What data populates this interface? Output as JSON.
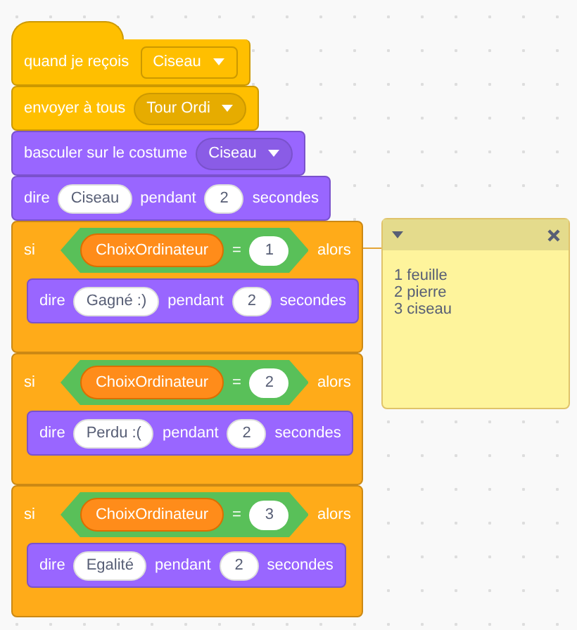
{
  "script": [
    {
      "kind": "hat",
      "color": "#ffbf00",
      "parts": [
        {
          "kind": "label",
          "text": "quand je reçois"
        },
        {
          "kind": "outlined_dropdown",
          "text": "Ciseau"
        }
      ]
    },
    {
      "kind": "stack",
      "color": "#ffbf00",
      "parts": [
        {
          "kind": "label",
          "text": "envoyer à tous"
        },
        {
          "kind": "dropdown",
          "text": "Tour Ordi"
        }
      ]
    },
    {
      "kind": "stack",
      "color": "#9966ff",
      "parts": [
        {
          "kind": "label",
          "text": "basculer sur le costume"
        },
        {
          "kind": "dropdown",
          "text": "Ciseau"
        }
      ]
    },
    {
      "kind": "stack",
      "color": "#9966ff",
      "parts": [
        {
          "kind": "label",
          "text": "dire"
        },
        {
          "kind": "input",
          "text": "Ciseau"
        },
        {
          "kind": "label",
          "text": "pendant"
        },
        {
          "kind": "input",
          "text": "2"
        },
        {
          "kind": "label",
          "text": "secondes"
        }
      ]
    },
    {
      "kind": "if",
      "color": "#ffab19",
      "label": "si",
      "condition": {
        "variable": "ChoixOrdinateur",
        "operator": "=",
        "value": "1"
      },
      "then_label": "alors",
      "has_comment": true,
      "body": [
        {
          "kind": "stack",
          "color": "#9966ff",
          "parts": [
            {
              "kind": "label",
              "text": "dire"
            },
            {
              "kind": "input",
              "text": "Gagné :)"
            },
            {
              "kind": "label",
              "text": "pendant"
            },
            {
              "kind": "input",
              "text": "2"
            },
            {
              "kind": "label",
              "text": "secondes"
            }
          ]
        }
      ]
    },
    {
      "kind": "if",
      "color": "#ffab19",
      "label": "si",
      "condition": {
        "variable": "ChoixOrdinateur",
        "operator": "=",
        "value": "2"
      },
      "then_label": "alors",
      "has_comment": false,
      "body": [
        {
          "kind": "stack",
          "color": "#9966ff",
          "parts": [
            {
              "kind": "label",
              "text": "dire"
            },
            {
              "kind": "input",
              "text": "Perdu :("
            },
            {
              "kind": "label",
              "text": "pendant"
            },
            {
              "kind": "input",
              "text": "2"
            },
            {
              "kind": "label",
              "text": "secondes"
            }
          ]
        }
      ]
    },
    {
      "kind": "if",
      "color": "#ffab19",
      "label": "si",
      "condition": {
        "variable": "ChoixOrdinateur",
        "operator": "=",
        "value": "3"
      },
      "then_label": "alors",
      "has_comment": false,
      "body": [
        {
          "kind": "stack",
          "color": "#9966ff",
          "parts": [
            {
              "kind": "label",
              "text": "dire"
            },
            {
              "kind": "input",
              "text": "Egalité"
            },
            {
              "kind": "label",
              "text": "pendant"
            },
            {
              "kind": "input",
              "text": "2"
            },
            {
              "kind": "label",
              "text": "secondes"
            }
          ]
        }
      ]
    }
  ],
  "comment": {
    "lines": [
      "1 feuille",
      "2 pierre",
      "3 ciseau"
    ]
  }
}
